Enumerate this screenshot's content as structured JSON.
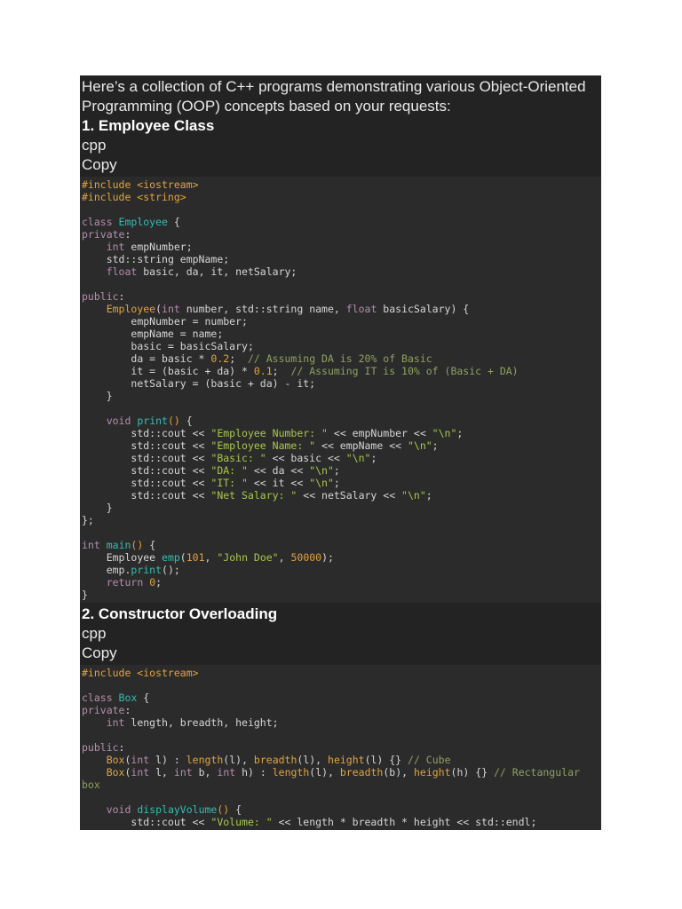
{
  "colors": {
    "page_background": "#ffffff",
    "prose_background": "#232323",
    "code_background": "#2b2b2b",
    "prose_text": "#e9e9e9",
    "heading_text": "#ffffff",
    "code_plain": "#d6d6d6",
    "code_keyword": "#b48ead",
    "code_type_function": "#35bdb2",
    "code_orange_meta_number": "#e2a43b",
    "code_string": "#a8c84a",
    "code_comment": "#8fa061"
  },
  "intro": {
    "text": "Here’s a collection of C++ programs demonstrating various Object-Oriented Programming (OOP) concepts based on your requests:"
  },
  "sections": [
    {
      "heading": "1. Employee Class",
      "lang": "cpp",
      "copy": "Copy",
      "code_lines": [
        [
          [
            "or",
            "#include <iostream>"
          ]
        ],
        [
          [
            "or",
            "#include <string>"
          ]
        ],
        [],
        [
          [
            "kw",
            "class "
          ],
          [
            "ty",
            "Employee"
          ],
          [
            "pl",
            " {"
          ]
        ],
        [
          [
            "kw",
            "private"
          ],
          [
            "pl",
            ":"
          ]
        ],
        [
          [
            "pl",
            "    "
          ],
          [
            "kw",
            "int"
          ],
          [
            "pl",
            " empNumber;"
          ]
        ],
        [
          [
            "pl",
            "    std::string empName;"
          ]
        ],
        [
          [
            "pl",
            "    "
          ],
          [
            "kw",
            "float"
          ],
          [
            "pl",
            " basic, da, it, netSalary;"
          ]
        ],
        [],
        [
          [
            "kw",
            "public"
          ],
          [
            "pl",
            ":"
          ]
        ],
        [
          [
            "pl",
            "    "
          ],
          [
            "or",
            "Employee"
          ],
          [
            "pl",
            "("
          ],
          [
            "kw",
            "int"
          ],
          [
            "pl",
            " number, std::string name, "
          ],
          [
            "kw",
            "float"
          ],
          [
            "pl",
            " basicSalary) {"
          ]
        ],
        [
          [
            "pl",
            "        empNumber = number;"
          ]
        ],
        [
          [
            "pl",
            "        empName = name;"
          ]
        ],
        [
          [
            "pl",
            "        basic = basicSalary;"
          ]
        ],
        [
          [
            "pl",
            "        da = basic * "
          ],
          [
            "or",
            "0.2"
          ],
          [
            "pl",
            ";  "
          ],
          [
            "cm",
            "// Assuming DA is 20% of Basic"
          ]
        ],
        [
          [
            "pl",
            "        it = (basic + da) * "
          ],
          [
            "or",
            "0.1"
          ],
          [
            "pl",
            ";  "
          ],
          [
            "cm",
            "// Assuming IT is 10% of (Basic + DA)"
          ]
        ],
        [
          [
            "pl",
            "        netSalary = (basic + da) - it;"
          ]
        ],
        [
          [
            "pl",
            "    }"
          ]
        ],
        [],
        [
          [
            "pl",
            "    "
          ],
          [
            "kw",
            "void"
          ],
          [
            "pl",
            " "
          ],
          [
            "ty",
            "print"
          ],
          [
            "or",
            "()"
          ],
          [
            "pl",
            " {"
          ]
        ],
        [
          [
            "pl",
            "        std::cout << "
          ],
          [
            "st",
            "\"Employee Number: \""
          ],
          [
            "pl",
            " << empNumber << "
          ],
          [
            "st",
            "\"\\n\""
          ],
          [
            "pl",
            ";"
          ]
        ],
        [
          [
            "pl",
            "        std::cout << "
          ],
          [
            "st",
            "\"Employee Name: \""
          ],
          [
            "pl",
            " << empName << "
          ],
          [
            "st",
            "\"\\n\""
          ],
          [
            "pl",
            ";"
          ]
        ],
        [
          [
            "pl",
            "        std::cout << "
          ],
          [
            "st",
            "\"Basic: \""
          ],
          [
            "pl",
            " << basic << "
          ],
          [
            "st",
            "\"\\n\""
          ],
          [
            "pl",
            ";"
          ]
        ],
        [
          [
            "pl",
            "        std::cout << "
          ],
          [
            "st",
            "\"DA: \""
          ],
          [
            "pl",
            " << da << "
          ],
          [
            "st",
            "\"\\n\""
          ],
          [
            "pl",
            ";"
          ]
        ],
        [
          [
            "pl",
            "        std::cout << "
          ],
          [
            "st",
            "\"IT: \""
          ],
          [
            "pl",
            " << it << "
          ],
          [
            "st",
            "\"\\n\""
          ],
          [
            "pl",
            ";"
          ]
        ],
        [
          [
            "pl",
            "        std::cout << "
          ],
          [
            "st",
            "\"Net Salary: \""
          ],
          [
            "pl",
            " << netSalary << "
          ],
          [
            "st",
            "\"\\n\""
          ],
          [
            "pl",
            ";"
          ]
        ],
        [
          [
            "pl",
            "    }"
          ]
        ],
        [
          [
            "pl",
            "};"
          ]
        ],
        [],
        [
          [
            "kw",
            "int"
          ],
          [
            "pl",
            " "
          ],
          [
            "ty",
            "main"
          ],
          [
            "or",
            "()"
          ],
          [
            "pl",
            " {"
          ]
        ],
        [
          [
            "pl",
            "    Employee "
          ],
          [
            "ty",
            "emp"
          ],
          [
            "pl",
            "("
          ],
          [
            "or",
            "101"
          ],
          [
            "pl",
            ", "
          ],
          [
            "st",
            "\"John Doe\""
          ],
          [
            "pl",
            ", "
          ],
          [
            "or",
            "50000"
          ],
          [
            "pl",
            ");"
          ]
        ],
        [
          [
            "pl",
            "    emp."
          ],
          [
            "ty",
            "print"
          ],
          [
            "pl",
            "();"
          ]
        ],
        [
          [
            "pl",
            "    "
          ],
          [
            "kw",
            "return"
          ],
          [
            "pl",
            " "
          ],
          [
            "or",
            "0"
          ],
          [
            "pl",
            ";"
          ]
        ],
        [
          [
            "pl",
            "}"
          ]
        ]
      ]
    },
    {
      "heading": "2. Constructor Overloading",
      "lang": "cpp",
      "copy": "Copy",
      "code_lines": [
        [
          [
            "or",
            "#include <iostream>"
          ]
        ],
        [],
        [
          [
            "kw",
            "class "
          ],
          [
            "ty",
            "Box"
          ],
          [
            "pl",
            " {"
          ]
        ],
        [
          [
            "kw",
            "private"
          ],
          [
            "pl",
            ":"
          ]
        ],
        [
          [
            "pl",
            "    "
          ],
          [
            "kw",
            "int"
          ],
          [
            "pl",
            " length, breadth, height;"
          ]
        ],
        [],
        [
          [
            "kw",
            "public"
          ],
          [
            "pl",
            ":"
          ]
        ],
        [
          [
            "pl",
            "    "
          ],
          [
            "or",
            "Box"
          ],
          [
            "pl",
            "("
          ],
          [
            "kw",
            "int"
          ],
          [
            "pl",
            " l) : "
          ],
          [
            "or",
            "length"
          ],
          [
            "pl",
            "(l), "
          ],
          [
            "or",
            "breadth"
          ],
          [
            "pl",
            "(l), "
          ],
          [
            "or",
            "height"
          ],
          [
            "pl",
            "(l) {} "
          ],
          [
            "cm",
            "// Cube"
          ]
        ],
        [
          [
            "pl",
            "    "
          ],
          [
            "or",
            "Box"
          ],
          [
            "pl",
            "("
          ],
          [
            "kw",
            "int"
          ],
          [
            "pl",
            " l, "
          ],
          [
            "kw",
            "int"
          ],
          [
            "pl",
            " b, "
          ],
          [
            "kw",
            "int"
          ],
          [
            "pl",
            " h) : "
          ],
          [
            "or",
            "length"
          ],
          [
            "pl",
            "(l), "
          ],
          [
            "or",
            "breadth"
          ],
          [
            "pl",
            "(b), "
          ],
          [
            "or",
            "height"
          ],
          [
            "pl",
            "(h) {} "
          ],
          [
            "cm",
            "// Rectangular box"
          ]
        ],
        [],
        [
          [
            "pl",
            "    "
          ],
          [
            "kw",
            "void"
          ],
          [
            "pl",
            " "
          ],
          [
            "ty",
            "displayVolume"
          ],
          [
            "or",
            "()"
          ],
          [
            "pl",
            " {"
          ]
        ],
        [
          [
            "pl",
            "        std::cout << "
          ],
          [
            "st",
            "\"Volume: \""
          ],
          [
            "pl",
            " << length * breadth * height << std::endl;"
          ]
        ]
      ]
    }
  ]
}
